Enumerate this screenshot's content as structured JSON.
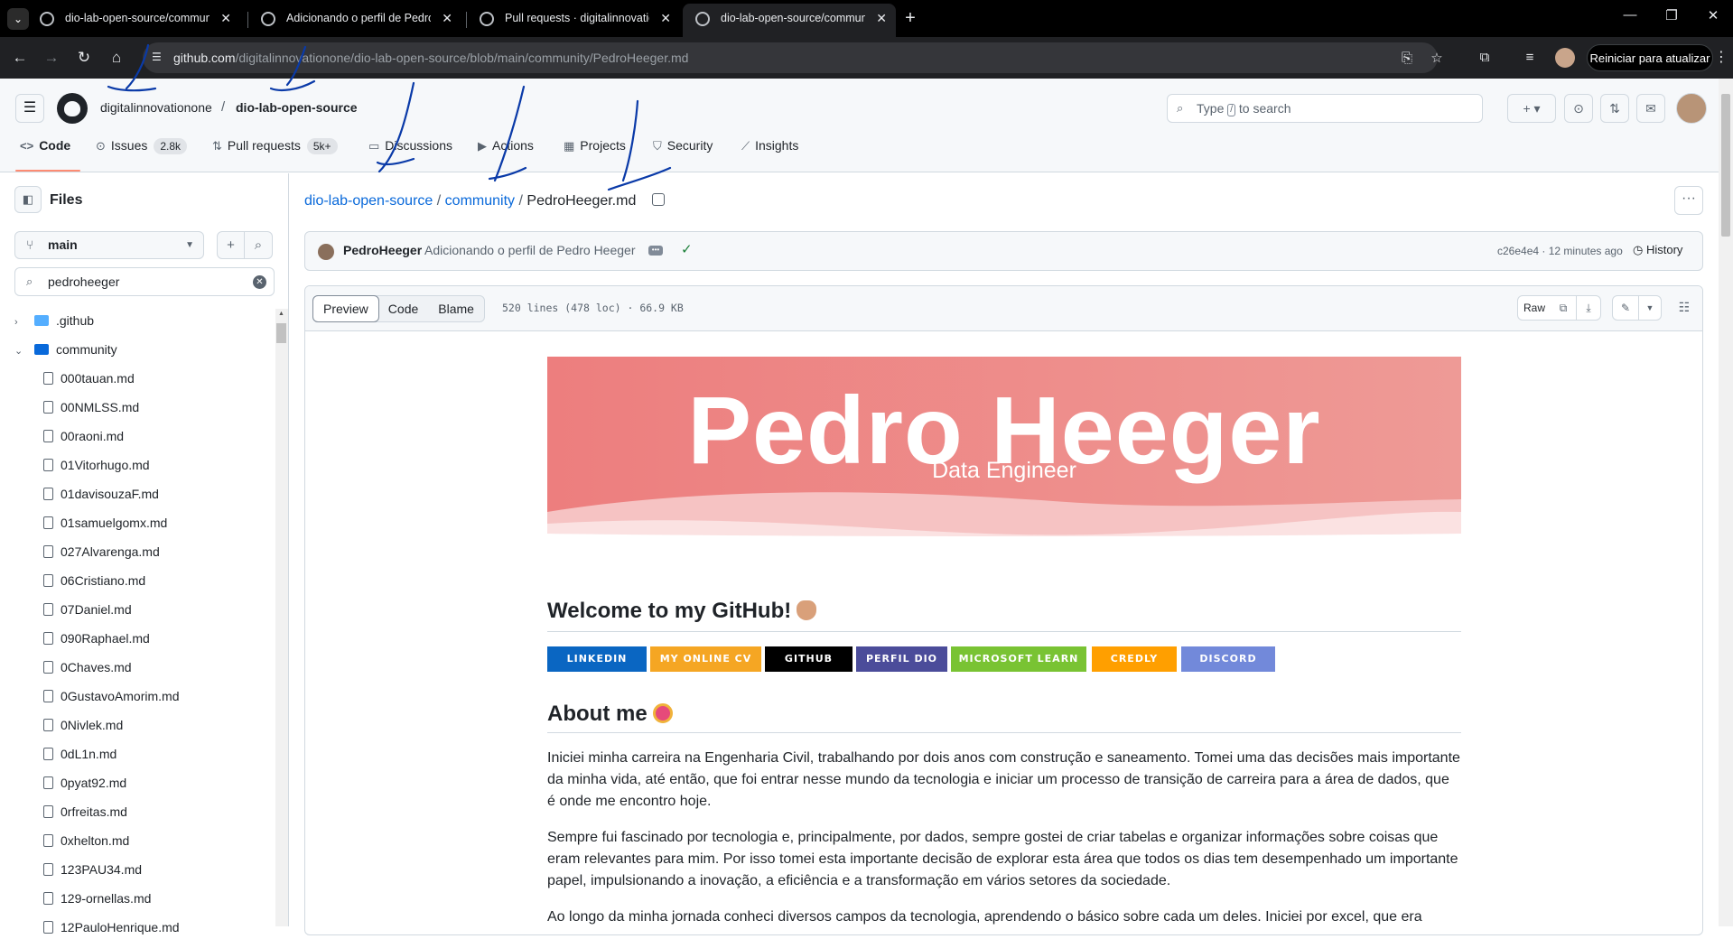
{
  "browser": {
    "tabs": [
      {
        "title": "dio-lab-open-source/communi",
        "active": false
      },
      {
        "title": "Adicionando o perfil de Pedro H",
        "active": false
      },
      {
        "title": "Pull requests · digitalinnovation",
        "active": false
      },
      {
        "title": "dio-lab-open-source/communi",
        "active": true
      }
    ],
    "url_host": "github.com",
    "url_path": "/digitalinnovationone/dio-lab-open-source/blob/main/community/PedroHeeger.md",
    "update_button": "Reiniciar para atualizar"
  },
  "header": {
    "owner": "digitalinnovationone",
    "separator": "/",
    "repo": "dio-lab-open-source",
    "search_prefix": "Type",
    "search_key": "/",
    "search_suffix": "to search"
  },
  "repo_nav": {
    "code": "Code",
    "issues": "Issues",
    "issues_count": "2.8k",
    "pulls": "Pull requests",
    "pulls_count": "5k+",
    "discussions": "Discussions",
    "actions": "Actions",
    "projects": "Projects",
    "security": "Security",
    "insights": "Insights"
  },
  "sidebar": {
    "title": "Files",
    "branch": "main",
    "filter_value": "pedroheeger",
    "folders": [
      ".github",
      "community"
    ],
    "files": [
      "000tauan.md",
      "00NMLSS.md",
      "00raoni.md",
      "01Vitorhugo.md",
      "01davisouzaF.md",
      "01samuelgomx.md",
      "027Alvarenga.md",
      "06Cristiano.md",
      "07Daniel.md",
      "090Raphael.md",
      "0Chaves.md",
      "0GustavoAmorim.md",
      "0Nivlek.md",
      "0dL1n.md",
      "0pyat92.md",
      "0rfreitas.md",
      "0xhelton.md",
      "123PAU34.md",
      "129-ornellas.md",
      "12PauloHenrique.md"
    ]
  },
  "breadcrumb": {
    "repo": "dio-lab-open-source",
    "folder": "community",
    "file": "PedroHeeger.md",
    "sep": "/"
  },
  "commit": {
    "author": "PedroHeeger",
    "message": "Adicionando o perfil de Pedro Heeger",
    "sha_time": "c26e4e4 · 12 minutes ago",
    "history": "History"
  },
  "file_header": {
    "tabs": [
      "Preview",
      "Code",
      "Blame"
    ],
    "meta": "520 lines (478 loc) · 66.9 KB",
    "raw": "Raw"
  },
  "readme": {
    "banner_title": "Pedro Heeger",
    "banner_subtitle": "Data Engineer",
    "banner_color": "#e98a8a",
    "welcome_heading": "Welcome to my GitHub!",
    "badges": [
      {
        "label": "LINKEDIN",
        "color": "#0a66c2"
      },
      {
        "label": "MY ONLINE CV",
        "color": "#f5a623"
      },
      {
        "label": "GITHUB",
        "color": "#000000"
      },
      {
        "label": "PERFIL DIO",
        "color": "#4b4c9a"
      },
      {
        "label": "MICROSOFT LEARN",
        "color": "#79c333"
      },
      {
        "label": "CREDLY",
        "color": "#ff9f00"
      },
      {
        "label": "DISCORD",
        "color": "#7289da"
      }
    ],
    "about_heading": "About me",
    "paragraphs": [
      "Iniciei minha carreira na Engenharia Civil, trabalhando por dois anos com construção e saneamento. Tomei uma das decisões mais importante da minha vida, até então, que foi entrar nesse mundo da tecnologia e iniciar um processo de transição de carreira para a área de dados, que é onde me encontro hoje.",
      "Sempre fui fascinado por tecnologia e, principalmente, por dados, sempre gostei de criar tabelas e organizar informações sobre coisas que eram relevantes para mim. Por isso tomei esta importante decisão de explorar esta área que todos os dias tem desempenhado um importante papel, impulsionando a inovação, a eficiência e a transformação em vários setores da sociedade.",
      "Ao longo da minha jornada conheci diversos campos da tecnologia, aprendendo o básico sobre cada um deles. Iniciei por excel, que era minha"
    ]
  }
}
